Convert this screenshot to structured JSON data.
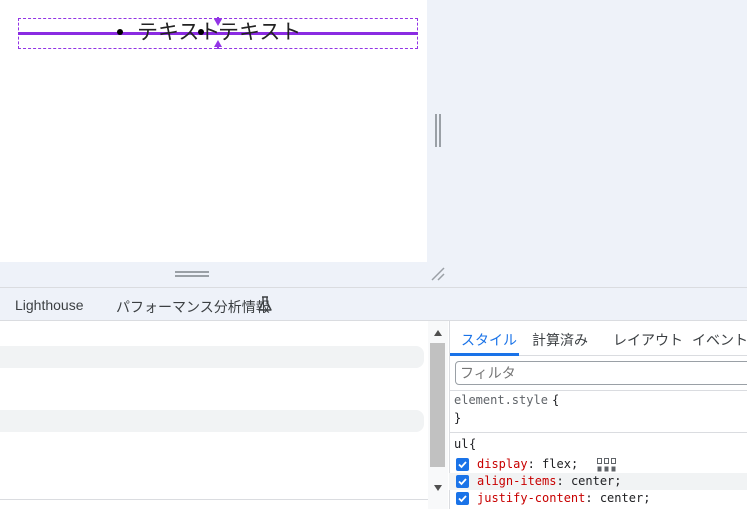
{
  "preview": {
    "items": [
      "テキスト",
      "テキスト"
    ]
  },
  "devtools_tabs": {
    "lighthouse": "Lighthouse",
    "performance_insights": "パフォーマンス分析情報"
  },
  "sidebar_tabs": [
    {
      "label": "スタイル",
      "active": true
    },
    {
      "label": "計算済み",
      "active": false
    },
    {
      "label": "レイアウト",
      "active": false
    },
    {
      "label": "イベント リ",
      "active": false
    }
  ],
  "styles": {
    "filter_placeholder": "フィルタ",
    "element_style_selector": "element.style",
    "open_brace": " {",
    "close_brace": "}",
    "rule_selector": "ul",
    "properties": [
      {
        "name": "display",
        "value": "flex",
        "checked": true
      },
      {
        "name": "align-items",
        "value": "center",
        "checked": true
      },
      {
        "name": "justify-content",
        "value": "center",
        "checked": true
      }
    ]
  },
  "colors": {
    "accent": "#1a73e8",
    "highlight_purple": "#9334e6",
    "property_name": "#c80000"
  }
}
